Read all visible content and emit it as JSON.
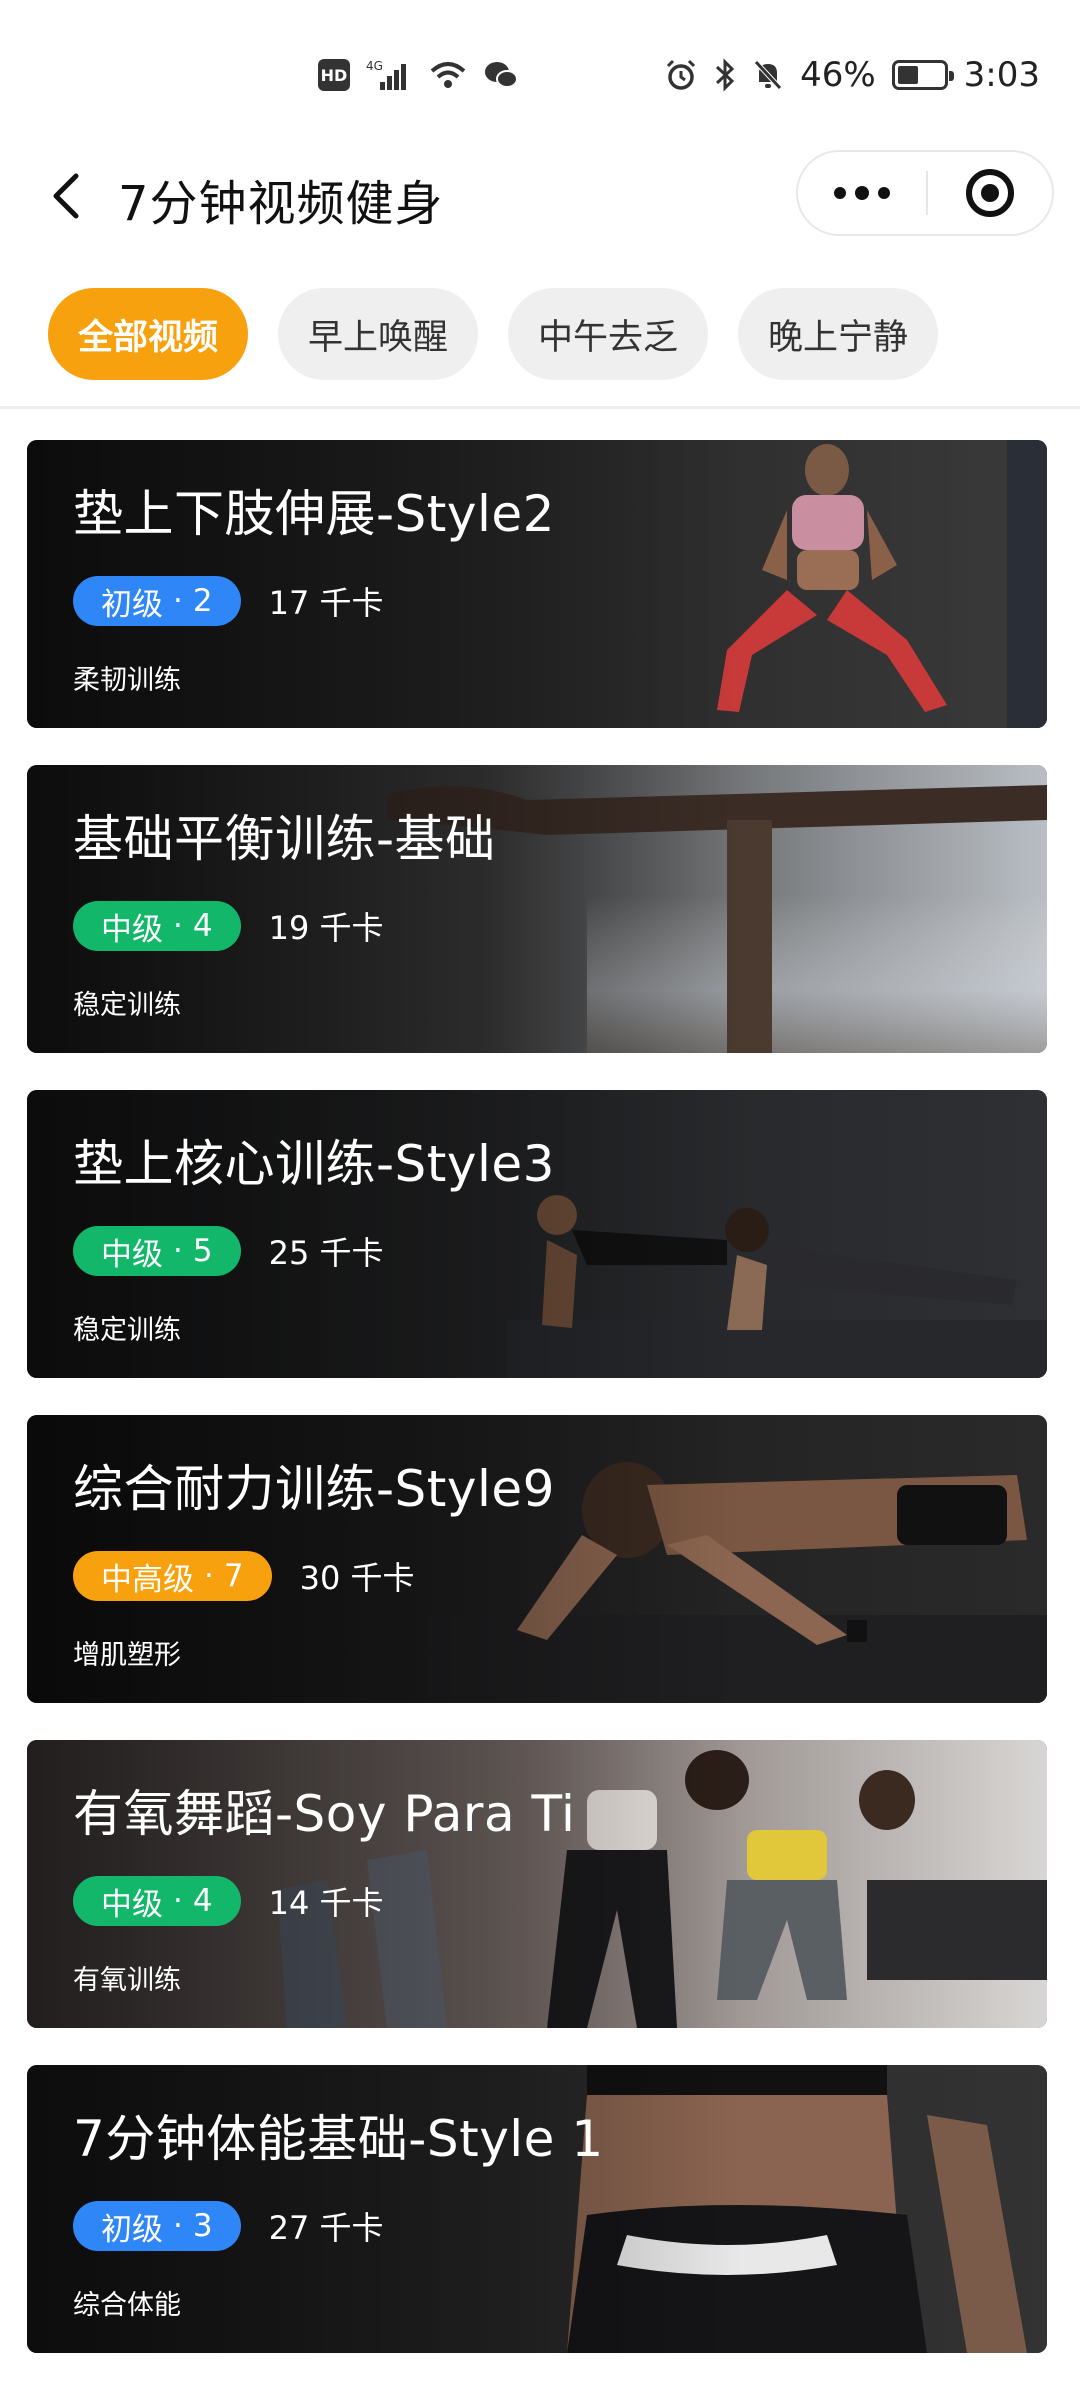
{
  "status_bar": {
    "hd": "HD",
    "net": "4G",
    "battery_percent": "46%",
    "battery_level": 0.46,
    "time": "3:03"
  },
  "header": {
    "title": "7分钟视频健身"
  },
  "tabs": [
    {
      "label": "全部视频",
      "active": true
    },
    {
      "label": "早上唤醒",
      "active": false
    },
    {
      "label": "中午去乏",
      "active": false
    },
    {
      "label": "晚上宁静",
      "active": false
    }
  ],
  "cards": [
    {
      "title": "垫上下肢伸展-Style2",
      "level": "初级",
      "level_num": "2",
      "kcal": "17 千卡",
      "category": "柔韧训练",
      "level_color": "#2f86f6"
    },
    {
      "title": "基础平衡训练-基础",
      "level": "中级",
      "level_num": "4",
      "kcal": "19 千卡",
      "category": "稳定训练",
      "level_color": "#12b76a"
    },
    {
      "title": "垫上核心训练-Style3",
      "level": "中级",
      "level_num": "5",
      "kcal": "25 千卡",
      "category": "稳定训练",
      "level_color": "#12b76a"
    },
    {
      "title": "综合耐力训练-Style9",
      "level": "中高级",
      "level_num": "7",
      "kcal": "30 千卡",
      "category": "增肌塑形",
      "level_color": "#f7a10e"
    },
    {
      "title": "有氧舞蹈-Soy Para Ti",
      "level": "中级",
      "level_num": "4",
      "kcal": "14 千卡",
      "category": "有氧训练",
      "level_color": "#12b76a"
    },
    {
      "title": "7分钟体能基础-Style 1",
      "level": "初级",
      "level_num": "3",
      "kcal": "27 千卡",
      "category": "综合体能",
      "level_color": "#2f86f6"
    }
  ],
  "colors": {
    "accent": "#f7a10e",
    "beginner": "#2f86f6",
    "intermediate": "#12b76a",
    "upper_intermediate": "#f7a10e"
  }
}
